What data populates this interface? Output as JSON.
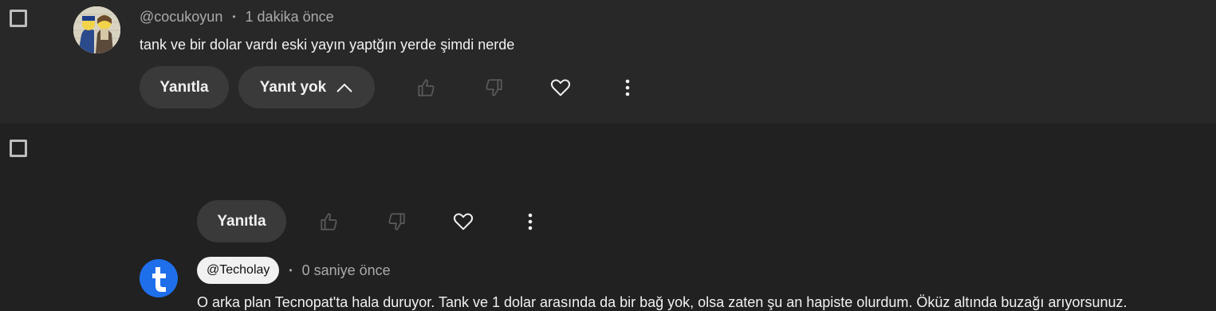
{
  "comments": [
    {
      "handle": "@cocukoyun",
      "time": "1 dakika önce",
      "text": "tank ve bir dolar vardı eski yayın yaptğın yerde şimdi nerde",
      "reply_label": "Yanıtla",
      "replies_label": "Yanıt yok",
      "avatar": "cartoon-avatar"
    },
    {
      "handle": "@Techolay",
      "time": "0 saniye önce",
      "text": "O arka plan Tecnopat'ta hala duruyor. Tank ve 1 dolar arasında da bir bağ yok, olsa zaten şu an hapiste olurdum. Öküz altında buzağı arıyorsunuz.",
      "reply_label": "Yanıtla",
      "avatar_letter": "t",
      "avatar_color": "#1f6feb"
    }
  ],
  "separator": "•",
  "icons": [
    "like-icon",
    "dislike-icon",
    "heart-icon",
    "more-icon",
    "chevron-up-icon"
  ]
}
